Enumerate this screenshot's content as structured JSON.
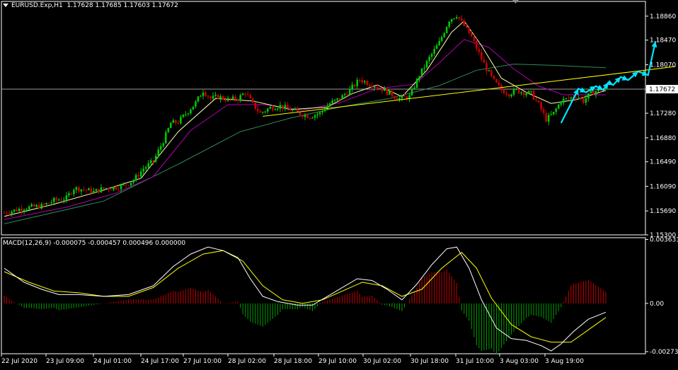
{
  "header": {
    "symbol": "EURUSD.Exp,H1",
    "ohlc": "1.17628 1.17685 1.17603 1.17672",
    "macd_label": "MACD(12,26,9) -0.000075 -0.000457 0.000496 0.000000"
  },
  "colors": {
    "background": "#000000",
    "bull_candle": "#00c800",
    "bear_candle": "#c80000",
    "ma_fast": "#ffffb4",
    "ma_mid": "#b200b2",
    "ma_slow": "#2e8b57",
    "trendline": "#ffff00",
    "forecast_arrow": "#00e5ff",
    "macd_line": "#ffffff",
    "signal_line": "#ffff00",
    "hist_pos": "#c80000",
    "hist_neg": "#00a000"
  },
  "chart_data": [
    {
      "type": "candlestick",
      "title": "EURUSD.Exp,H1",
      "ylim": [
        1.153,
        1.191
      ],
      "y_ticks": [
        "1.18860",
        "1.18470",
        "1.18070",
        "1.17672",
        "1.17280",
        "1.16880",
        "1.16490",
        "1.16090",
        "1.15690",
        "1.15300"
      ],
      "x_ticks": [
        "22 Jul 2020",
        "23 Jul 09:00",
        "24 Jul 01:00",
        "24 Jul 17:00",
        "27 Jul 10:00",
        "28 Jul 02:00",
        "28 Jul 18:00",
        "29 Jul 10:00",
        "30 Jul 02:00",
        "30 Jul 18:00",
        "31 Jul 10:00",
        "3 Aug 03:00",
        "3 Aug 19:00"
      ],
      "current_price": "1.17672",
      "close_path": [
        [
          0,
          1.1566
        ],
        [
          8,
          1.1574
        ],
        [
          15,
          1.1577
        ],
        [
          20,
          1.1586
        ],
        [
          25,
          1.159
        ],
        [
          28,
          1.1606
        ],
        [
          32,
          1.1604
        ],
        [
          36,
          1.16
        ],
        [
          40,
          1.1606
        ],
        [
          44,
          1.1607
        ],
        [
          48,
          1.161
        ],
        [
          52,
          1.1619
        ],
        [
          56,
          1.1638
        ],
        [
          60,
          1.165
        ],
        [
          64,
          1.1683
        ],
        [
          67,
          1.1712
        ],
        [
          70,
          1.1714
        ],
        [
          73,
          1.1727
        ],
        [
          77,
          1.1745
        ],
        [
          80,
          1.1765
        ],
        [
          83,
          1.1752
        ],
        [
          86,
          1.1755
        ],
        [
          90,
          1.175
        ],
        [
          94,
          1.1752
        ],
        [
          97,
          1.1762
        ],
        [
          100,
          1.1742
        ],
        [
          103,
          1.1728
        ],
        [
          107,
          1.1737
        ],
        [
          111,
          1.174
        ],
        [
          115,
          1.1734
        ],
        [
          119,
          1.1727
        ],
        [
          123,
          1.1723
        ],
        [
          127,
          1.1728
        ],
        [
          131,
          1.1744
        ],
        [
          135,
          1.1752
        ],
        [
          139,
          1.1766
        ],
        [
          143,
          1.1783
        ],
        [
          147,
          1.1776
        ],
        [
          151,
          1.177
        ],
        [
          155,
          1.176
        ],
        [
          159,
          1.1752
        ],
        [
          163,
          1.1755
        ],
        [
          167,
          1.179
        ],
        [
          171,
          1.1818
        ],
        [
          175,
          1.1843
        ],
        [
          179,
          1.188
        ],
        [
          182,
          1.1888
        ],
        [
          185,
          1.187
        ],
        [
          188,
          1.1852
        ],
        [
          191,
          1.1825
        ],
        [
          194,
          1.18
        ],
        [
          197,
          1.178
        ],
        [
          200,
          1.1766
        ],
        [
          203,
          1.176
        ],
        [
          206,
          1.1765
        ],
        [
          209,
          1.1762
        ],
        [
          212,
          1.176
        ],
        [
          215,
          1.1742
        ],
        [
          218,
          1.1718
        ],
        [
          221,
          1.1728
        ],
        [
          224,
          1.1748
        ],
        [
          227,
          1.1752
        ],
        [
          230,
          1.1756
        ],
        [
          233,
          1.1748
        ],
        [
          236,
          1.1761
        ],
        [
          239,
          1.1766
        ],
        [
          242,
          1.1768
        ]
      ],
      "moving_averages": {
        "fast": [
          [
            0,
            1.156
          ],
          [
            20,
            1.158
          ],
          [
            40,
            1.1603
          ],
          [
            55,
            1.1622
          ],
          [
            70,
            1.1698
          ],
          [
            85,
            1.1752
          ],
          [
            100,
            1.1748
          ],
          [
            115,
            1.1734
          ],
          [
            130,
            1.1738
          ],
          [
            140,
            1.176
          ],
          [
            150,
            1.1774
          ],
          [
            160,
            1.1755
          ],
          [
            170,
            1.1798
          ],
          [
            180,
            1.186
          ],
          [
            185,
            1.1878
          ],
          [
            192,
            1.1838
          ],
          [
            200,
            1.1785
          ],
          [
            210,
            1.1762
          ],
          [
            220,
            1.1744
          ],
          [
            230,
            1.175
          ],
          [
            242,
            1.1765
          ]
        ],
        "mid": [
          [
            0,
            1.1555
          ],
          [
            25,
            1.1575
          ],
          [
            45,
            1.1598
          ],
          [
            60,
            1.1625
          ],
          [
            75,
            1.17
          ],
          [
            90,
            1.1742
          ],
          [
            105,
            1.1742
          ],
          [
            120,
            1.1733
          ],
          [
            135,
            1.1745
          ],
          [
            150,
            1.1768
          ],
          [
            165,
            1.1775
          ],
          [
            175,
            1.181
          ],
          [
            185,
            1.1848
          ],
          [
            195,
            1.1835
          ],
          [
            205,
            1.18
          ],
          [
            215,
            1.1772
          ],
          [
            225,
            1.1758
          ],
          [
            242,
            1.1758
          ]
        ],
        "slow": [
          [
            0,
            1.1548
          ],
          [
            40,
            1.1585
          ],
          [
            70,
            1.1645
          ],
          [
            95,
            1.1698
          ],
          [
            115,
            1.172
          ],
          [
            135,
            1.1738
          ],
          [
            155,
            1.1752
          ],
          [
            175,
            1.1773
          ],
          [
            190,
            1.1798
          ],
          [
            205,
            1.1808
          ],
          [
            220,
            1.1806
          ],
          [
            242,
            1.1802
          ]
        ]
      },
      "trendline": [
        [
          104,
          1.1723
        ],
        [
          270,
          1.1804
        ]
      ],
      "forecast_path": [
        [
          224,
          1.1712
        ],
        [
          231,
          1.1768
        ],
        [
          234,
          1.1762
        ],
        [
          238,
          1.1772
        ],
        [
          241,
          1.1766
        ],
        [
          243,
          1.1778
        ],
        [
          245,
          1.1774
        ],
        [
          248,
          1.1787
        ],
        [
          251,
          1.1782
        ],
        [
          255,
          1.1796
        ],
        [
          259,
          1.179
        ],
        [
          262,
          1.1845
        ]
      ]
    },
    {
      "type": "macd",
      "title": "MACD(12,26,9)",
      "values": {
        "macd": -7.5e-05,
        "signal": -0.000457,
        "histogram": 0.000496,
        "extra": 0.0
      },
      "ylim": [
        -0.00286,
        0.00373
      ],
      "y_ticks": [
        "0.003631",
        "0.00",
        "-0.002739"
      ],
      "macd_path": [
        [
          0,
          0.002
        ],
        [
          8,
          0.0012
        ],
        [
          15,
          0.0008
        ],
        [
          22,
          0.0005
        ],
        [
          30,
          0.0005
        ],
        [
          40,
          0.0004
        ],
        [
          50,
          0.0005
        ],
        [
          60,
          0.001
        ],
        [
          68,
          0.0021
        ],
        [
          75,
          0.0028
        ],
        [
          82,
          0.0032
        ],
        [
          88,
          0.003
        ],
        [
          94,
          0.0026
        ],
        [
          99,
          0.0014
        ],
        [
          104,
          0.0004
        ],
        [
          110,
          0.0001
        ],
        [
          118,
          -0.0001
        ],
        [
          124,
          -0.0001
        ],
        [
          130,
          0.0004
        ],
        [
          136,
          0.0009
        ],
        [
          142,
          0.0014
        ],
        [
          148,
          0.0013
        ],
        [
          154,
          0.0008
        ],
        [
          160,
          0.0002
        ],
        [
          166,
          0.0011
        ],
        [
          172,
          0.0022
        ],
        [
          178,
          0.0031
        ],
        [
          182,
          0.0032
        ],
        [
          187,
          0.002
        ],
        [
          192,
          0.0002
        ],
        [
          198,
          -0.0014
        ],
        [
          204,
          -0.002
        ],
        [
          210,
          -0.0021
        ],
        [
          216,
          -0.0024
        ],
        [
          220,
          -0.0027
        ],
        [
          224,
          -0.0023
        ],
        [
          229,
          -0.0016
        ],
        [
          235,
          -0.0009
        ],
        [
          242,
          -0.0005
        ]
      ],
      "signal_path": [
        [
          0,
          0.0018
        ],
        [
          10,
          0.0012
        ],
        [
          20,
          0.0007
        ],
        [
          30,
          0.0006
        ],
        [
          40,
          0.0004
        ],
        [
          50,
          0.0004
        ],
        [
          60,
          0.0009
        ],
        [
          70,
          0.002
        ],
        [
          80,
          0.0028
        ],
        [
          88,
          0.003
        ],
        [
          96,
          0.0024
        ],
        [
          104,
          0.001
        ],
        [
          112,
          0.0002
        ],
        [
          120,
          0.0
        ],
        [
          128,
          0.0002
        ],
        [
          136,
          0.0007
        ],
        [
          144,
          0.0012
        ],
        [
          152,
          0.001
        ],
        [
          160,
          0.0004
        ],
        [
          168,
          0.0008
        ],
        [
          176,
          0.002
        ],
        [
          184,
          0.0029
        ],
        [
          190,
          0.002
        ],
        [
          196,
          0.0003
        ],
        [
          204,
          -0.0012
        ],
        [
          212,
          -0.0019
        ],
        [
          220,
          -0.0022
        ],
        [
          228,
          -0.0022
        ],
        [
          235,
          -0.0015
        ],
        [
          242,
          -0.0008
        ]
      ]
    }
  ]
}
